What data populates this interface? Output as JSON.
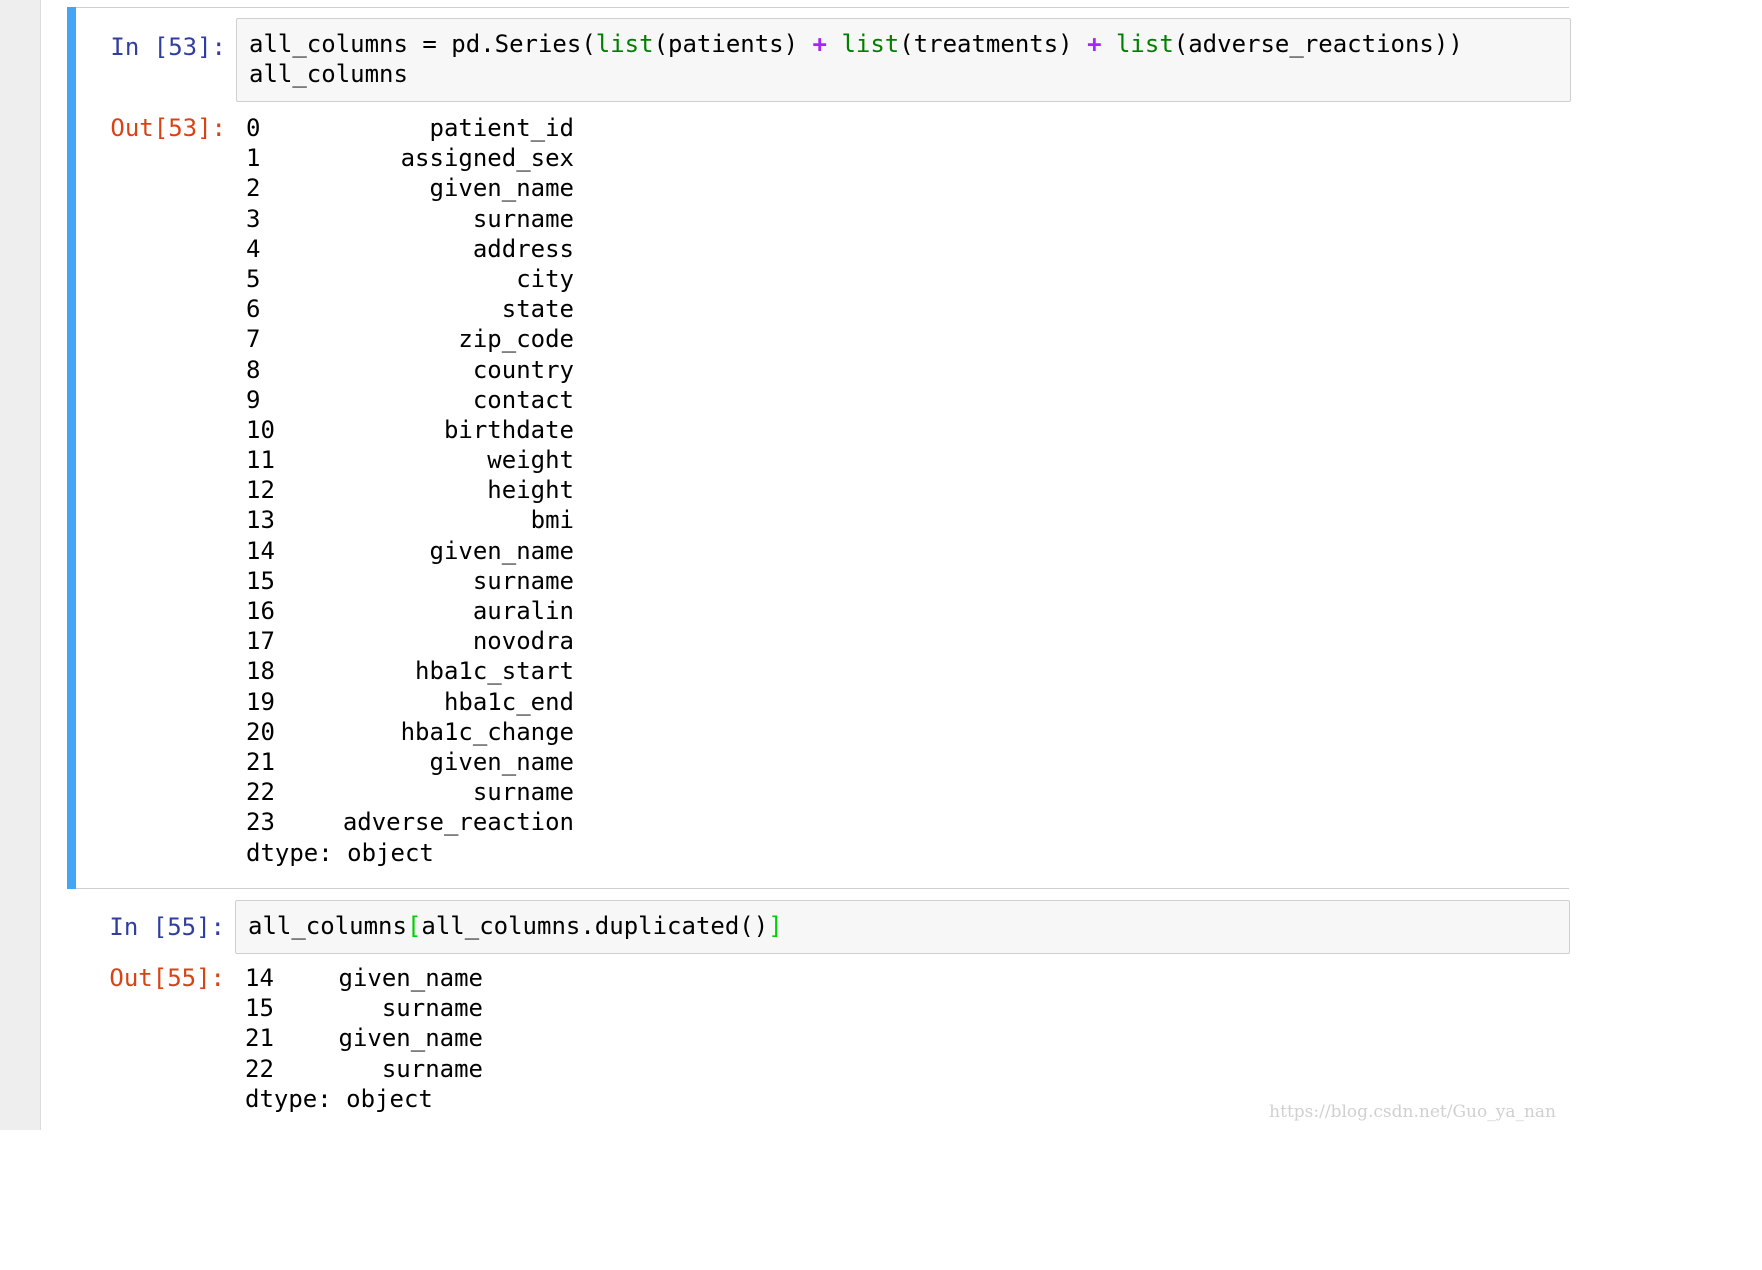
{
  "cells": [
    {
      "in_prompt": "In [53]:",
      "code_line1": {
        "t1": "all_columns = pd.Series(",
        "kw1": "list",
        "t2": "(patients) ",
        "op1": "+",
        "t3": " ",
        "kw2": "list",
        "t4": "(treatments) ",
        "op2": "+",
        "t5": " ",
        "kw3": "list",
        "t6": "(adverse_reactions))"
      },
      "code_line2": "all_columns",
      "out_prompt": "Out[53]:",
      "output_rows": [
        {
          "index": "0",
          "value": "patient_id"
        },
        {
          "index": "1",
          "value": "assigned_sex"
        },
        {
          "index": "2",
          "value": "given_name"
        },
        {
          "index": "3",
          "value": "surname"
        },
        {
          "index": "4",
          "value": "address"
        },
        {
          "index": "5",
          "value": "city"
        },
        {
          "index": "6",
          "value": "state"
        },
        {
          "index": "7",
          "value": "zip_code"
        },
        {
          "index": "8",
          "value": "country"
        },
        {
          "index": "9",
          "value": "contact"
        },
        {
          "index": "10",
          "value": "birthdate"
        },
        {
          "index": "11",
          "value": "weight"
        },
        {
          "index": "12",
          "value": "height"
        },
        {
          "index": "13",
          "value": "bmi"
        },
        {
          "index": "14",
          "value": "given_name"
        },
        {
          "index": "15",
          "value": "surname"
        },
        {
          "index": "16",
          "value": "auralin"
        },
        {
          "index": "17",
          "value": "novodra"
        },
        {
          "index": "18",
          "value": "hba1c_start"
        },
        {
          "index": "19",
          "value": "hba1c_end"
        },
        {
          "index": "20",
          "value": "hba1c_change"
        },
        {
          "index": "21",
          "value": "given_name"
        },
        {
          "index": "22",
          "value": "surname"
        },
        {
          "index": "23",
          "value": "adverse_reaction"
        }
      ],
      "dtype_line": "dtype: object"
    },
    {
      "in_prompt": "In [55]:",
      "code_line1": {
        "t1": "all_columns",
        "b1": "[",
        "t2": "all_columns.duplicated()",
        "b2": "]"
      },
      "out_prompt": "Out[55]:",
      "output_rows": [
        {
          "index": "14",
          "value": "given_name"
        },
        {
          "index": "15",
          "value": "surname"
        },
        {
          "index": "21",
          "value": "given_name"
        },
        {
          "index": "22",
          "value": "surname"
        }
      ],
      "dtype_line": "dtype: object"
    }
  ],
  "watermark": "https://blog.csdn.net/Guo_ya_nan",
  "colors": {
    "in_prompt": "#303f9f",
    "out_prompt": "#d84315",
    "builtin": "#008000",
    "operator": "#aa22ff",
    "selected_bar": "#42a5f5"
  }
}
